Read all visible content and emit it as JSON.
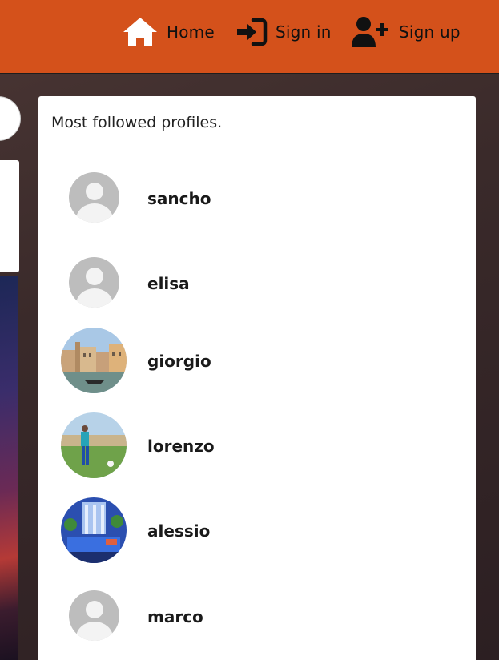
{
  "nav": {
    "home_label": "Home",
    "signin_label": "Sign in",
    "signup_label": "Sign up",
    "home_icon": "home-icon",
    "signin_icon": "sign-in-icon",
    "signup_icon": "user-plus-icon",
    "bar_color": "#d4511b"
  },
  "card": {
    "title": "Most followed profiles."
  },
  "profiles": [
    {
      "name": "sancho",
      "avatar": "default-avatar"
    },
    {
      "name": "elisa",
      "avatar": "default-avatar"
    },
    {
      "name": "giorgio",
      "avatar": "venice-canal-photo"
    },
    {
      "name": "lorenzo",
      "avatar": "soccer-player-photo"
    },
    {
      "name": "alessio",
      "avatar": "blue-fountain-photo"
    },
    {
      "name": "marco",
      "avatar": "default-avatar"
    }
  ]
}
